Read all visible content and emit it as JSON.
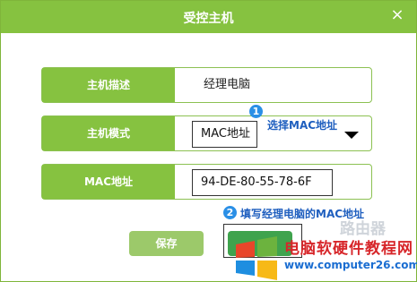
{
  "dialog": {
    "title": "受控主机",
    "close_glyph": "×"
  },
  "rows": {
    "description": {
      "label": "主机描述",
      "value": "经理电脑"
    },
    "mode": {
      "label": "主机模式",
      "selected": "MAC地址"
    },
    "mac": {
      "label": "MAC地址",
      "value": "94-DE-80-55-78-6F"
    }
  },
  "annotations": {
    "step1": {
      "number": "1",
      "text": "选择MAC地址"
    },
    "step2": {
      "number": "2",
      "text": "填写经理电脑的MAC地址"
    }
  },
  "buttons": {
    "save_label": "保存"
  },
  "watermark": {
    "line1": "电脑软硬件教程网",
    "line2": "www.computer26.com",
    "faint": "路由器"
  },
  "colors": {
    "accent_green": "#86c240",
    "annotation_blue": "#1f5fbf",
    "badge_blue": "#2a8fe6",
    "watermark_red": "#d7262a"
  }
}
